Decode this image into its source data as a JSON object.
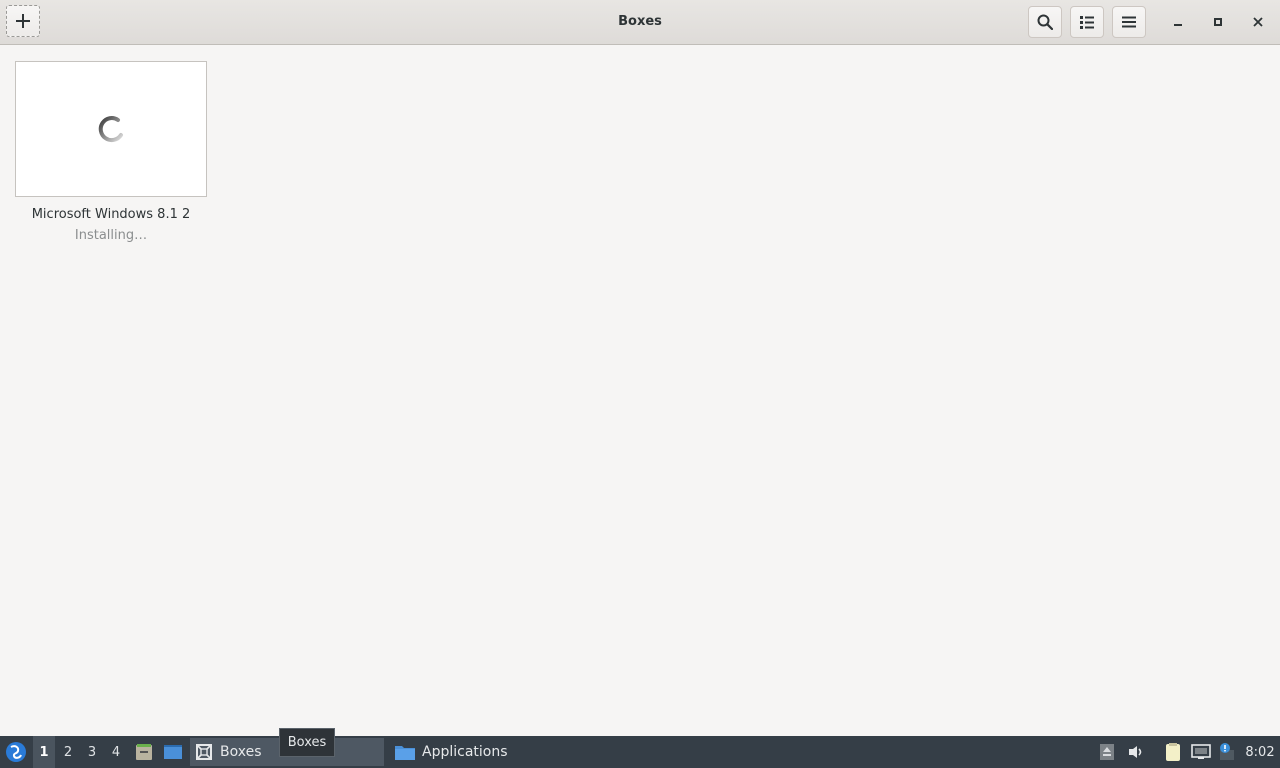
{
  "window": {
    "title": "Boxes"
  },
  "boxes": [
    {
      "name": "Microsoft Windows 8.1 2",
      "status": "Installing…"
    }
  ],
  "taskbar": {
    "workspaces": [
      "1",
      "2",
      "3",
      "4"
    ],
    "active_workspace": "1",
    "tasks": [
      {
        "label": "Boxes"
      },
      {
        "label": "Applications"
      }
    ],
    "tooltip": "Boxes",
    "clock": "8:02"
  },
  "icons": {
    "new": "plus-icon",
    "search": "search-icon",
    "view": "list-view-icon",
    "menu": "hamburger-menu-icon",
    "minimize": "minimize-icon",
    "maximize": "maximize-icon",
    "close": "close-icon"
  },
  "colors": {
    "taskbar_bg": "#353e47",
    "window_bg": "#f6f5f4"
  }
}
